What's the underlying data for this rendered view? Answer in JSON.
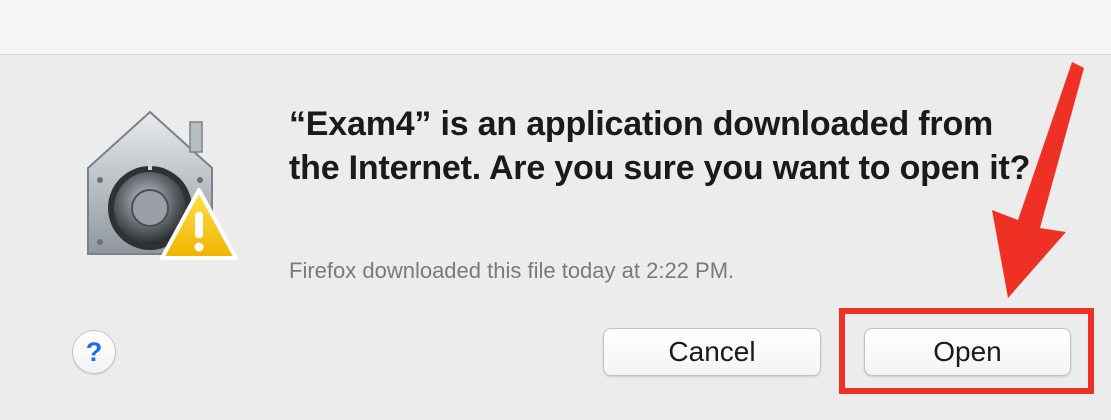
{
  "dialog": {
    "title_line": "“Exam4” is an application downloaded from the Internet. Are you sure you want to open it?",
    "subtext": "Firefox downloaded this file today at 2:22 PM.",
    "help_label": "?",
    "cancel_label": "Cancel",
    "open_label": "Open",
    "icon": "gatekeeper-vault-warning-icon"
  },
  "annotation": {
    "color": "#ee3124",
    "arrow_icon": "red-arrow-icon"
  }
}
